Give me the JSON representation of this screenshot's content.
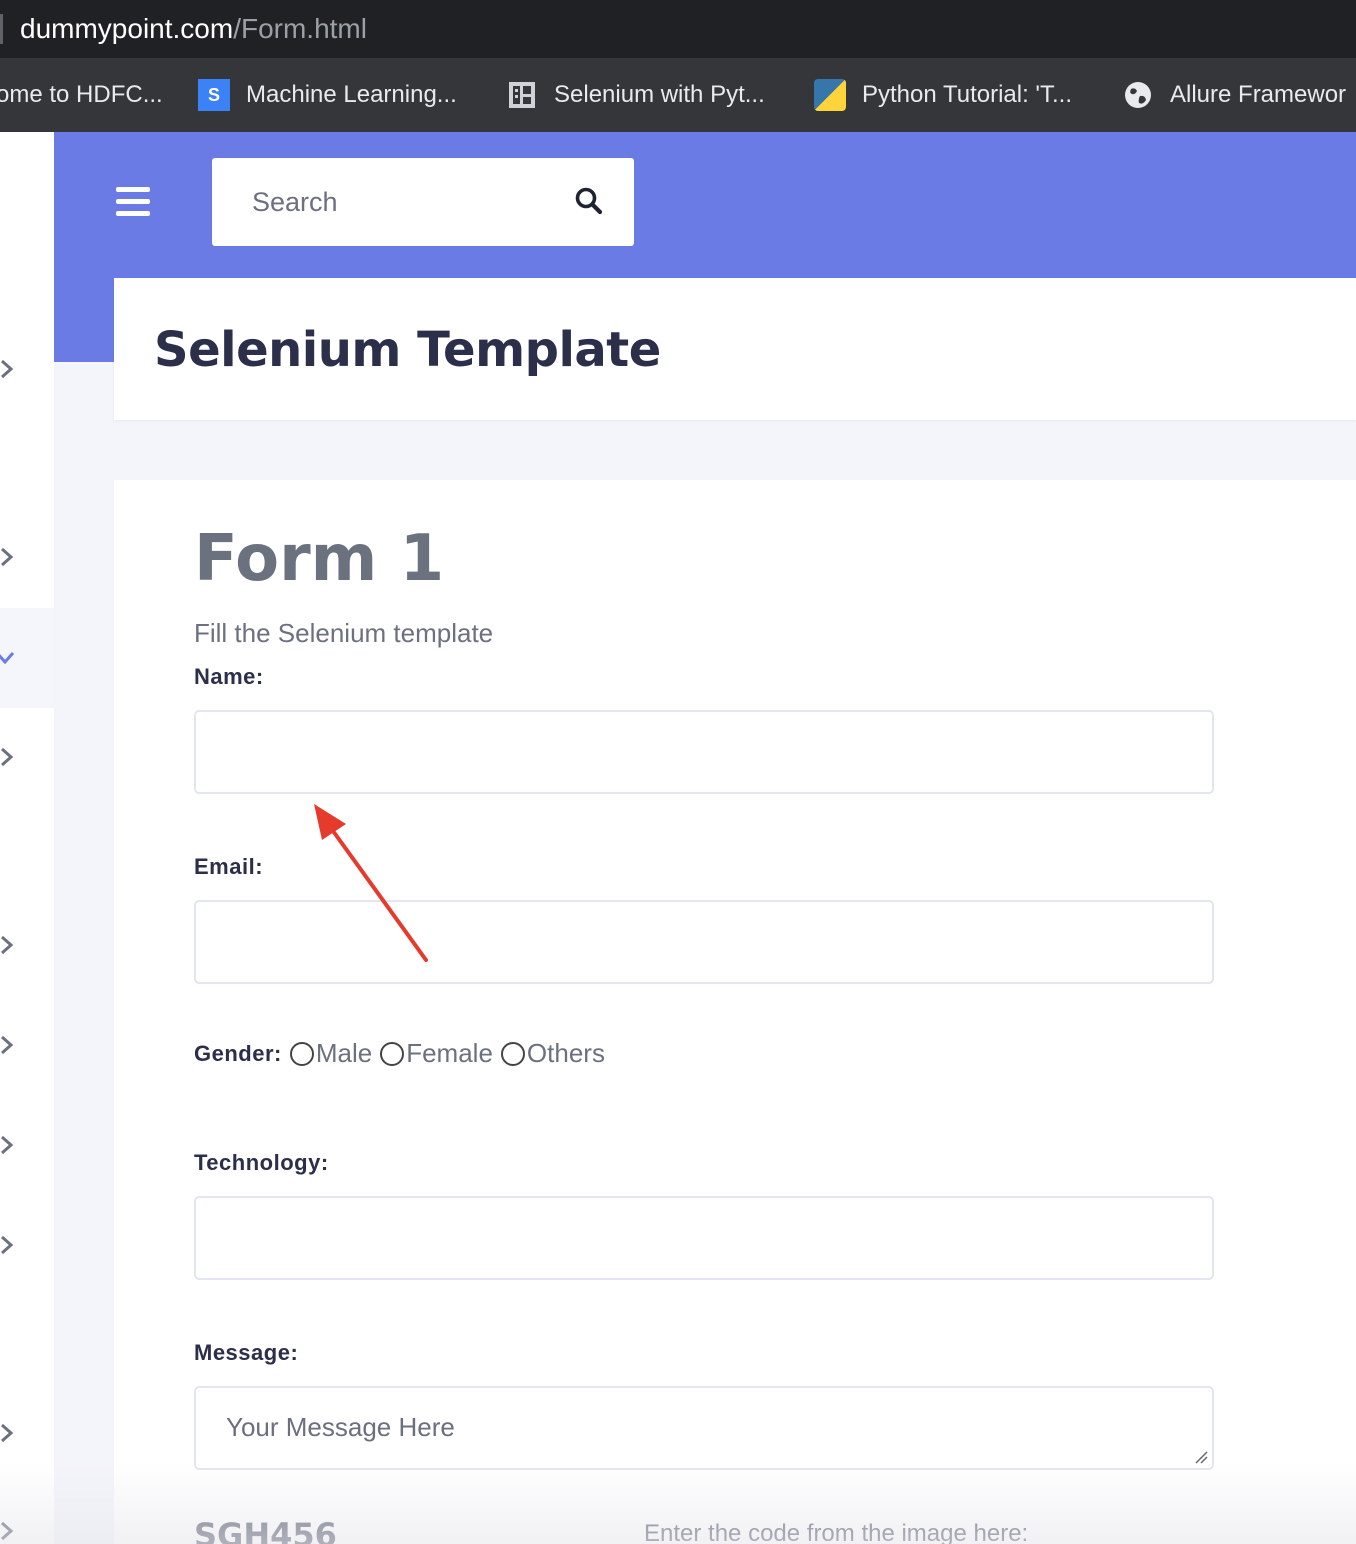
{
  "browser": {
    "url_domain": "dummypoint.com",
    "url_path": "/Form.html"
  },
  "bookmarks": [
    {
      "label": "ome to HDFC...",
      "icon": "none"
    },
    {
      "label": "Machine Learning...",
      "icon": "s-icon"
    },
    {
      "label": "Selenium with Pyt...",
      "icon": "selenium-icon"
    },
    {
      "label": "Python Tutorial: 'T...",
      "icon": "python-icon"
    },
    {
      "label": "Allure Framewor",
      "icon": "globe-icon"
    }
  ],
  "header": {
    "search_placeholder": "Search"
  },
  "page_title": "Selenium Template",
  "form": {
    "title": "Form 1",
    "subtitle": "Fill the Selenium template",
    "name_label": "Name:",
    "email_label": "Email:",
    "gender_label": "Gender:",
    "gender_options": [
      "Male",
      "Female",
      "Others"
    ],
    "technology_label": "Technology:",
    "message_label": "Message:",
    "message_placeholder": "Your Message Here",
    "captcha_code": "SGH456",
    "captcha_hint": "Enter the code from the image here:"
  },
  "colors": {
    "header_bg": "#6a7be6",
    "title_text": "#2b2f4a",
    "muted_text": "#6b717f",
    "annotation_arrow": "#e53b2c"
  }
}
